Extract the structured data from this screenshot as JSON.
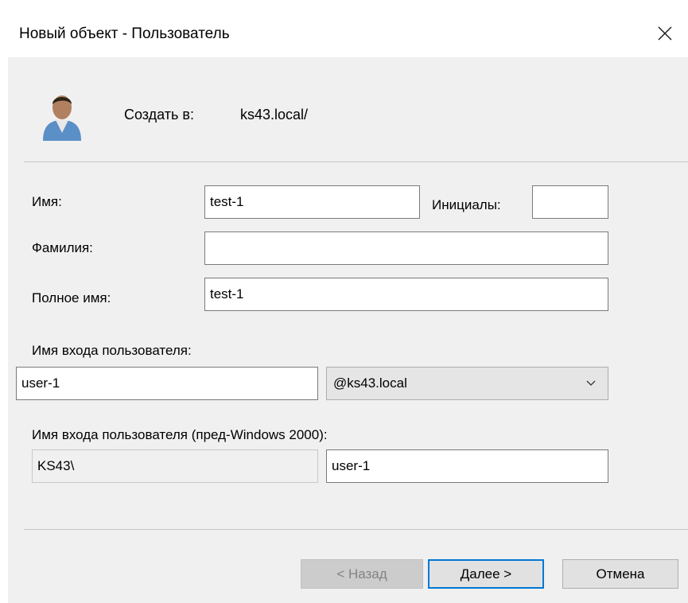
{
  "window": {
    "title": "Новый объект - Пользователь"
  },
  "header": {
    "create_in_label": "Создать в:",
    "create_in_value": "ks43.local/"
  },
  "form": {
    "first_name": {
      "label": "Имя:",
      "value": "test-1"
    },
    "initials": {
      "label": "Инициалы:",
      "value": ""
    },
    "last_name": {
      "label": "Фамилия:",
      "value": ""
    },
    "full_name": {
      "label": "Полное имя:",
      "value": "test-1"
    },
    "logon_name": {
      "label": "Имя входа пользователя:",
      "value": "user-1",
      "domain_selected": "@ks43.local"
    },
    "pre2000": {
      "label": "Имя входа пользователя (пред-Windows 2000):",
      "domain_prefix": "KS43\\",
      "value": "user-1"
    }
  },
  "buttons": {
    "back": "< Назад",
    "next_underlined": "Д",
    "next_rest": "алее >",
    "cancel": "Отмена"
  },
  "colors": {
    "dialog_background": "#f0f0f0",
    "default_button_border": "#0078d7",
    "disabled_text": "#838383"
  },
  "icons": {
    "close": "close-icon",
    "user": "user-icon",
    "dropdown": "chevron-down-icon"
  }
}
